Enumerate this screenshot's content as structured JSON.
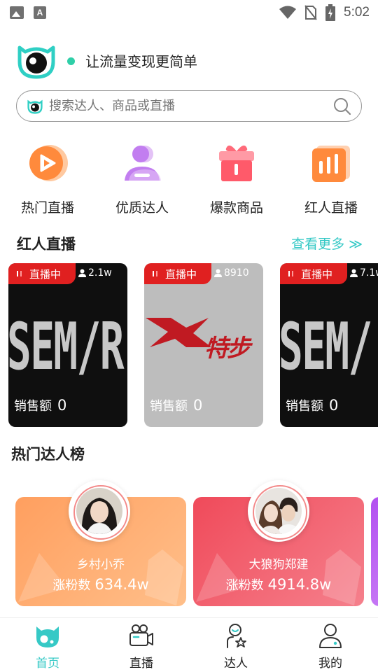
{
  "status_bar": {
    "time": "5:02"
  },
  "header": {
    "slogan": "让流量变现更简单"
  },
  "search": {
    "placeholder": "搜索达人、商品或直播"
  },
  "quick_nav": [
    {
      "label": "热门直播"
    },
    {
      "label": "优质达人"
    },
    {
      "label": "爆款商品"
    },
    {
      "label": "红人直播"
    }
  ],
  "live_section": {
    "title": "红人直播",
    "see_more": "查看更多 ≫",
    "cards": [
      {
        "badge": "直播中",
        "viewers": "2.1w",
        "brand": "SEM/R",
        "sales_label": "销售额",
        "sales_value": "0"
      },
      {
        "badge": "直播中",
        "viewers": "8910",
        "brand": "特步",
        "sales_label": "销售额",
        "sales_value": "0"
      },
      {
        "badge": "直播中",
        "viewers": "7.1w",
        "brand": "SEM/",
        "sales_label": "销售额",
        "sales_value": "0"
      }
    ]
  },
  "talent_section": {
    "title": "热门达人榜",
    "cards": [
      {
        "name": "乡村小乔",
        "fans_label": "涨粉数",
        "fans_value": "634.4w"
      },
      {
        "name": "大狼狗郑建",
        "fans_label": "涨粉数",
        "fans_value": "4914.8w"
      }
    ]
  },
  "bottom_nav": [
    {
      "label": "首页",
      "active": true
    },
    {
      "label": "直播",
      "active": false
    },
    {
      "label": "达人",
      "active": false
    },
    {
      "label": "我的",
      "active": false
    }
  ],
  "colors": {
    "accent": "#36c9c6",
    "live_red": "#e02020",
    "orange": "#ff9f5f",
    "red": "#f04a5a"
  }
}
